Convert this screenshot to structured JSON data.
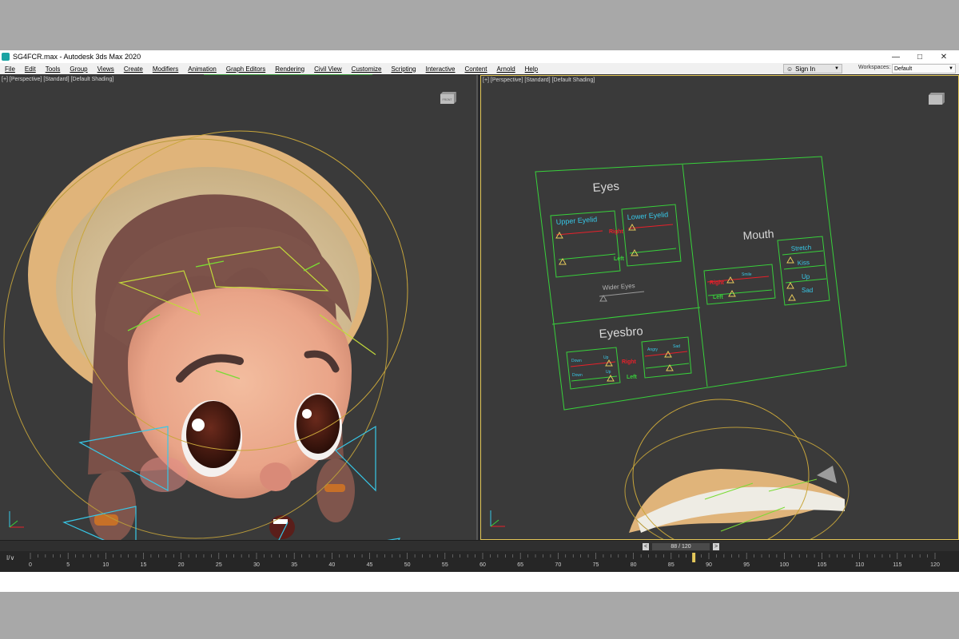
{
  "window": {
    "title": "SG4FCR.max - Autodesk 3ds Max 2020",
    "minimize": "—",
    "maximize": "□",
    "close": "✕"
  },
  "menu": {
    "items": [
      "File",
      "Edit",
      "Tools",
      "Group",
      "Views",
      "Create",
      "Modifiers",
      "Animation",
      "Graph Editors",
      "Rendering",
      "Civil View",
      "Customize",
      "Scripting",
      "Interactive",
      "Content",
      "Arnold",
      "Help"
    ],
    "signin_label": "Sign In",
    "workspaces_label": "Workspaces:",
    "workspaces_value": "Default"
  },
  "viewport_left": {
    "label": "[+] [Perspective] [Standard] [Default Shading]"
  },
  "viewport_right": {
    "label": "[+] [Perspective] [Standard] [Default Shading]"
  },
  "viewcube_label": "FRONT",
  "rig_panel": {
    "eyes_title": "Eyes",
    "upper_eyelid": "Upper Eyelid",
    "lower_eyelid": "Lower Eyelid",
    "right_red": "Right",
    "left_green": "Left",
    "wider_eyes": "Wider Eyes",
    "mouth_title": "Mouth",
    "smile": "Smile",
    "stretch": "Stretch",
    "kiss": "Kiss",
    "up": "Up",
    "sad": "Sad",
    "eyesbro_title": "Eyesbro",
    "down": "Down",
    "angry": "Angry"
  },
  "timeline": {
    "frame_display": "88 / 120",
    "prev": "<",
    "next": ">",
    "track_icon": "I/∨",
    "current_frame": 88,
    "total_frames": 120,
    "ticks": [
      "0",
      "5",
      "10",
      "15",
      "20",
      "25",
      "30",
      "35",
      "40",
      "45",
      "50",
      "55",
      "60",
      "65",
      "70",
      "75",
      "80",
      "85",
      "90",
      "95",
      "100",
      "105",
      "110",
      "115",
      "120"
    ]
  },
  "colors": {
    "accent_yellow": "#e4c85a",
    "rig_green": "#38d13a",
    "rig_cyan": "#37c8e8",
    "rig_red": "#e8202a"
  }
}
